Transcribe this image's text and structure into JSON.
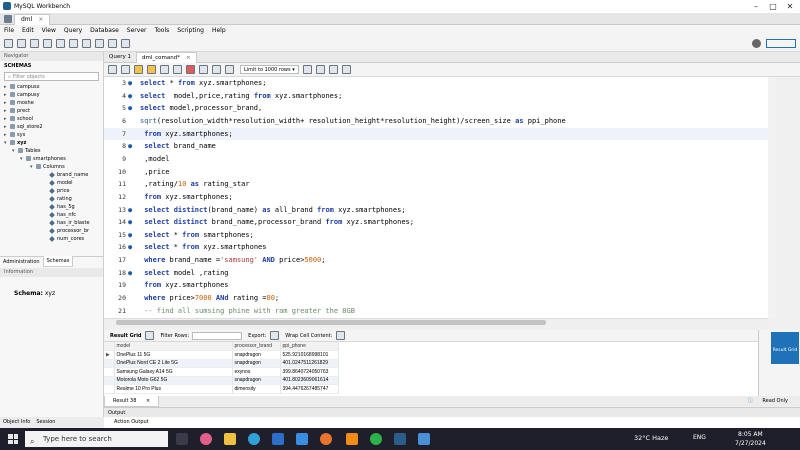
{
  "window": {
    "title": "MySQL Workbench",
    "connection_tab": "dml",
    "controls": [
      "–",
      "□",
      "✕"
    ]
  },
  "menu": [
    "File",
    "Edit",
    "View",
    "Query",
    "Database",
    "Server",
    "Tools",
    "Scripting",
    "Help"
  ],
  "navigator": {
    "header": "Navigator",
    "schemas_label": "SCHEMAS",
    "filter_placeholder": "Filter objects",
    "schemas": [
      "campusx",
      "campusy",
      "moshe",
      "prect",
      "school",
      "sql_store2",
      "sys",
      "xyz"
    ],
    "xyz_children": {
      "tables_label": "Tables",
      "table": "smartphones",
      "columns_label": "Columns",
      "columns": [
        "brand_name",
        "model",
        "price",
        "rating",
        "has_5g",
        "has_nfc",
        "has_ir_blaste",
        "processor_br",
        "num_cores"
      ]
    },
    "tabs": [
      "Administration",
      "Schemas"
    ],
    "info_header": "Information",
    "schema_label": "Schema:",
    "schema_value": "xyz",
    "bottom_tabs": [
      "Object Info",
      "Session"
    ]
  },
  "editor": {
    "tabs": [
      "Query 1",
      "dml_comand*"
    ],
    "limit_label": "Limit to 1000 rows",
    "lines": [
      {
        "n": "3",
        "dot": true,
        "html": "<span class='kw'>select</span> * <span class='kw'>from</span> xyz.smartphones;"
      },
      {
        "n": "4",
        "dot": true,
        "html": "<span class='kw'>select</span>  model,price,rating <span class='kw'>from</span> xyz.smartphones;"
      },
      {
        "n": "5",
        "dot": true,
        "html": "<span class='kw'>select</span> model,processor_brand,"
      },
      {
        "n": "6",
        "dot": false,
        "html": "<span class='fn'>sqrt</span>(resolution_width*resolution_width+ resolution_height*resolution_height)/screen_size <span class='kw'>as</span> ppi_phone"
      },
      {
        "n": "7",
        "dot": false,
        "html": " <span class='kw'>from</span> xyz.smartphones;",
        "hl": true
      },
      {
        "n": "8",
        "dot": true,
        "html": " <span class='kw'>select</span> brand_name"
      },
      {
        "n": "9",
        "dot": false,
        "html": " ,model"
      },
      {
        "n": "10",
        "dot": false,
        "html": " ,price"
      },
      {
        "n": "11",
        "dot": false,
        "html": " ,rating/<span class='num'>10</span> <span class='kw'>as</span> rating_star"
      },
      {
        "n": "12",
        "dot": false,
        "html": " <span class='kw'>from</span> xyz.smartphones;"
      },
      {
        "n": "13",
        "dot": true,
        "html": " <span class='kw'>select distinct</span>(brand_name) <span class='kw'>as</span> all_brand <span class='kw'>from</span> xyz.smartphones;"
      },
      {
        "n": "14",
        "dot": true,
        "html": " <span class='kw'>select distinct</span> brand_name,processor_brand <span class='kw'>from</span> xyz.smartphones;"
      },
      {
        "n": "15",
        "dot": true,
        "html": " <span class='kw'>select</span> * <span class='kw'>from</span> smartphones;"
      },
      {
        "n": "16",
        "dot": true,
        "html": " <span class='kw'>select</span> * <span class='kw'>from</span> xyz.smartphones"
      },
      {
        "n": "17",
        "dot": false,
        "html": " <span class='kw'>where</span> brand_name =<span class='str'>'samsung'</span> <span class='kw'>AND</span> price><span class='num'>5000</span>;"
      },
      {
        "n": "18",
        "dot": true,
        "html": " <span class='kw'>select</span> model ,rating"
      },
      {
        "n": "19",
        "dot": false,
        "html": " <span class='kw'>from</span> xyz.smartphones"
      },
      {
        "n": "20",
        "dot": false,
        "html": " <span class='kw'>where</span> price><span class='num'>7000</span> <span class='kw'>ANd</span> rating =<span class='num'>80</span>;"
      },
      {
        "n": "21",
        "dot": false,
        "html": " <span class='cm'>-- find all sumsing phine with ram greater the 8GB</span>"
      }
    ]
  },
  "result": {
    "toolbar": {
      "result_grid": "Result Grid",
      "filter_rows": "Filter Rows:",
      "export": "Export:",
      "wrap": "Wrap Cell Content:"
    },
    "columns": [
      "model",
      "processor_brand",
      "ppi_phone"
    ],
    "rows": [
      [
        "OnePlus 11 5G",
        "snapdragon",
        "525.9210168998101"
      ],
      [
        "OnePlus Nord CE 2 Lite 5G",
        "snapdragon",
        "401.0247511261829"
      ],
      [
        "Samsung Galaxy A14 5G",
        "exynos",
        "399.8640724050763"
      ],
      [
        "Motorola Moto G62 5G",
        "snapdragon",
        "401.8023609061614"
      ],
      [
        "Realme 10 Pro Plus",
        "dimensity",
        "394.4476267485747"
      ]
    ],
    "result_tab": "Result 38",
    "readonly": "Read Only",
    "side_button": "Result Grid",
    "output_header": "Output",
    "output_action": "Action Output"
  },
  "taskbar": {
    "search_placeholder": "Type here to search",
    "weather": "32°C  Haze",
    "time": "8:05 AM",
    "date": "7/27/2024",
    "lang": "ENG"
  },
  "colors": {
    "accent": "#1f72b8",
    "keyword": "#1f3fa3",
    "taskbar": "#1f1f2b"
  }
}
